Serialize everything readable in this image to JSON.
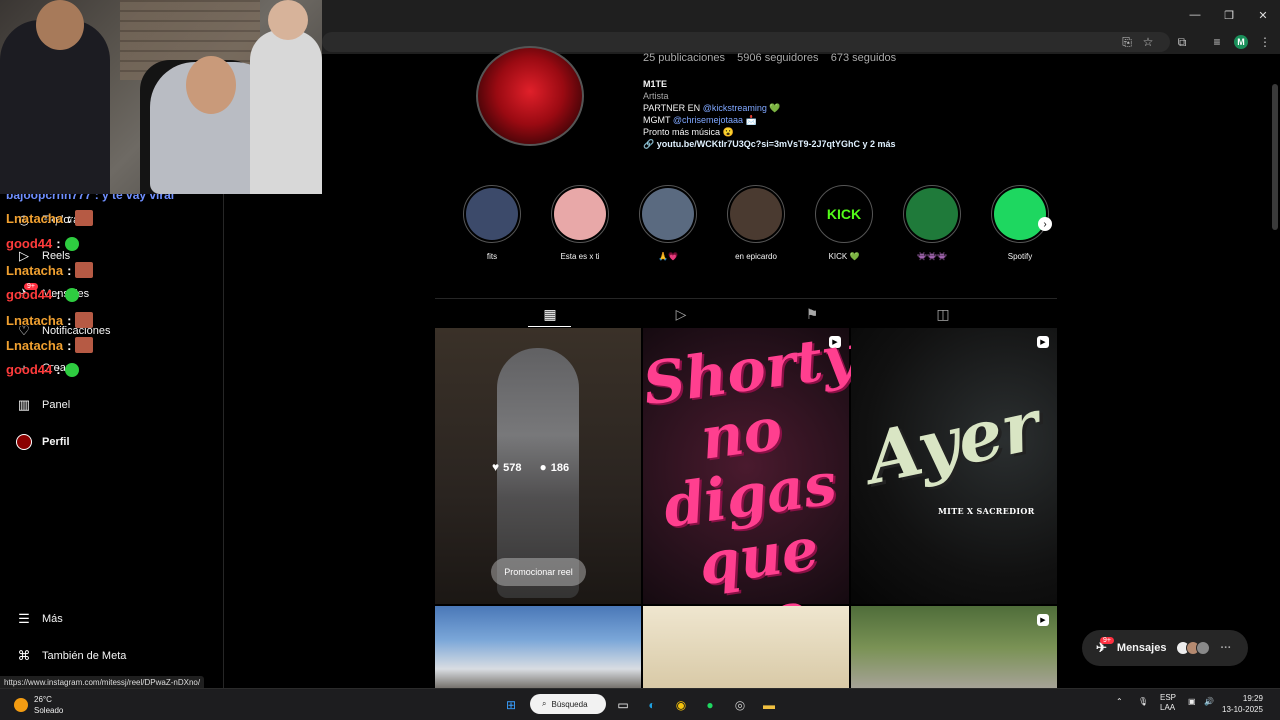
{
  "browser": {
    "window_controls": [
      "—",
      "❐",
      "✕"
    ]
  },
  "statusbar": {
    "url": "https://www.instagram.com/mitessj/reel/DPwaZ-nDXno/"
  },
  "chat": {
    "top_line": "bajoopcrnn777 : y te vay viral",
    "lines": [
      {
        "user": "Lnatacha",
        "sep": ":",
        "color": "#f0a030"
      },
      {
        "user": "good44",
        "sep": ":",
        "color": "#ff3b3b"
      },
      {
        "user": "Lnatacha",
        "sep": ":",
        "color": "#f0a030"
      },
      {
        "user": "good44",
        "sep": ":",
        "color": "#ff3b3b"
      },
      {
        "user": "Lnatacha",
        "sep": ":",
        "color": "#f0a030"
      },
      {
        "user": "Lnatacha",
        "sep": ":",
        "color": "#f0a030"
      },
      {
        "user": "good44",
        "sep": ":",
        "color": "#ff3b3b"
      }
    ]
  },
  "sidebar": {
    "explore_label": "Explorar",
    "reels_label": "Reels",
    "messages_label": "Mensajes",
    "messages_badge": "9+",
    "notifications_label": "Notificaciones",
    "create_label": "Crear",
    "panel_label": "Panel",
    "profile_label": "Perfil",
    "more_label": "Más",
    "meta_label": "También de Meta"
  },
  "profile": {
    "stats": "25 publicaciones    5906 seguidores    673 seguidos",
    "name": "M1TE",
    "category": "Artista",
    "bio_partner_prefix": "PARTNER EN ",
    "bio_partner_link": "@kickstreaming",
    "bio_partner_suffix": " 💚",
    "bio_mgmt_prefix": "MGMT ",
    "bio_mgmt_link": "@chrisemejotaaa",
    "bio_mgmt_suffix": " 📩",
    "bio_line3": "Pronto más música 😮",
    "link_text": "youtu.be/WCKtlr7U3Qc?si=3mVsT9-2J7qtYGhC y 2 más"
  },
  "highlights": [
    {
      "label": "fits",
      "color": "#3c4a6a"
    },
    {
      "label": "Esta es x ti",
      "color": "#e8a8a8"
    },
    {
      "label": "🙏💗",
      "color": "#5a6a80"
    },
    {
      "label": "en epicardo",
      "color": "#4a3a30"
    },
    {
      "label": "KICK 💚",
      "color": "#000000"
    },
    {
      "label": "👾👾👾",
      "color": "#1f7a3a"
    },
    {
      "label": "Spotify",
      "color": "#1ed760"
    }
  ],
  "highlight_kick_text": "KICK",
  "posts": {
    "likes": "578",
    "comments": "186",
    "promote_button": "Promocionar reel",
    "post2_text": "Shorty no digas que no",
    "post3_title": "Ayer",
    "post3_sub": "MITE X SACREDIOR"
  },
  "messages_pill": {
    "label": "Mensajes",
    "badge": "9+"
  },
  "taskbar": {
    "temp": "26°C",
    "weather": "Soleado",
    "search": "Búsqueda",
    "lang1": "ESP",
    "lang2": "LAA",
    "time": "19:29",
    "date": "13-10-2025"
  }
}
